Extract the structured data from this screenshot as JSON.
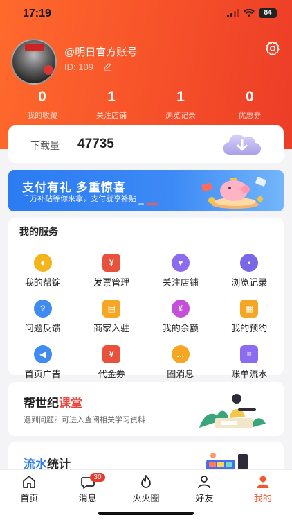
{
  "status": {
    "time": "17:19",
    "battery": "84"
  },
  "profile": {
    "username": "@明日官方账号",
    "id_label": "ID:",
    "id_value": "109"
  },
  "stats": [
    {
      "value": "0",
      "label": "我的收藏"
    },
    {
      "value": "1",
      "label": "关注店铺"
    },
    {
      "value": "1",
      "label": "浏览记录"
    },
    {
      "value": "0",
      "label": "优惠券"
    }
  ],
  "downloads": {
    "label": "下载量",
    "value": "47735"
  },
  "banner": {
    "title": "支付有礼 多重惊喜",
    "subtitle": "千万补贴等你来拿，支付就享补贴"
  },
  "services": {
    "title": "我的服务",
    "items": [
      {
        "label": "我的帮锭",
        "icon": "coins-icon",
        "color": "#f4b41a"
      },
      {
        "label": "发票管理",
        "icon": "invoice-icon",
        "color": "#e8513c"
      },
      {
        "label": "关注店铺",
        "icon": "heart-icon",
        "color": "#8b6cf0"
      },
      {
        "label": "浏览记录",
        "icon": "footprint-icon",
        "color": "#7a67e8"
      },
      {
        "label": "问题反馈",
        "icon": "question-icon",
        "color": "#3f8bf0"
      },
      {
        "label": "商家入驻",
        "icon": "store-icon",
        "color": "#f5a623"
      },
      {
        "label": "我的余额",
        "icon": "wallet-icon",
        "color": "#c54fd8"
      },
      {
        "label": "我的预约",
        "icon": "calendar-icon",
        "color": "#f5a623"
      },
      {
        "label": "首页广告",
        "icon": "megaphone-icon",
        "color": "#3f8bf0"
      },
      {
        "label": "代金券",
        "icon": "voucher-icon",
        "color": "#e8513c"
      },
      {
        "label": "圈消息",
        "icon": "chat-icon",
        "color": "#f5a623"
      },
      {
        "label": "账单流水",
        "icon": "bill-icon",
        "color": "#8b6cf0"
      }
    ]
  },
  "course": {
    "title_prefix": "帮世纪",
    "title_highlight": "课堂",
    "subtitle": "遇到问题？可进入查阅相关学习资料"
  },
  "flow": {
    "title_highlight": "流水",
    "title_suffix": "统计"
  },
  "tabbar": {
    "items": [
      {
        "label": "首页",
        "icon": "home-icon"
      },
      {
        "label": "消息",
        "icon": "message-icon",
        "badge": "30"
      },
      {
        "label": "火火圈",
        "icon": "flame-icon"
      },
      {
        "label": "好友",
        "icon": "friends-icon"
      },
      {
        "label": "我的",
        "icon": "user-icon",
        "active": true
      }
    ]
  }
}
